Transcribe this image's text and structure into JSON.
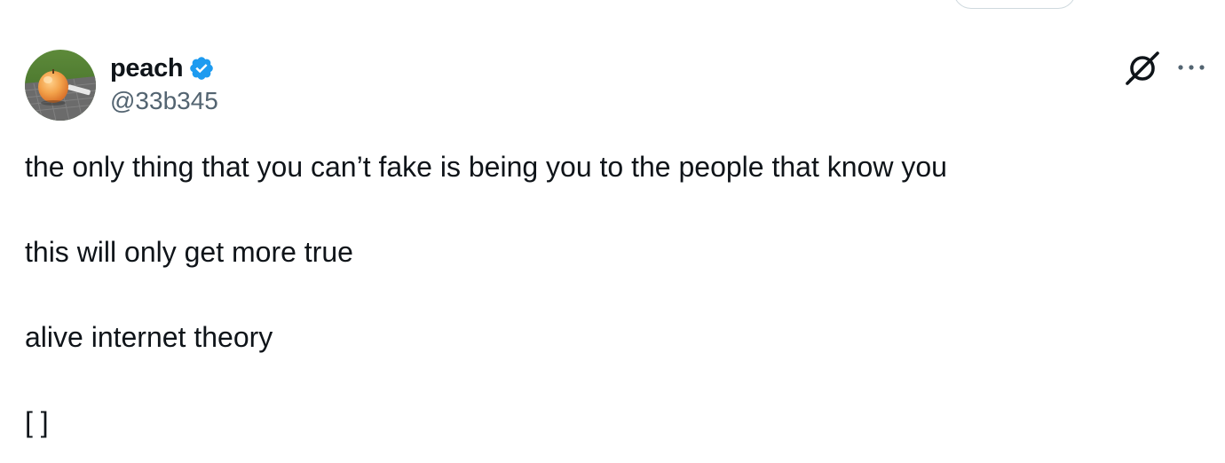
{
  "author": {
    "display_name": "peach",
    "handle": "@33b345",
    "verified": true,
    "verified_color": "#1d9bf0",
    "avatar_icon": "peach-photo-avatar"
  },
  "actions": {
    "grok_icon": "grok-icon",
    "more_icon": "more-options-icon"
  },
  "tweet": {
    "lines": [
      "the only thing that you can’t fake is being you to the people that know you",
      "this will only get more true",
      "alive internet theory",
      "[ ]"
    ]
  },
  "colors": {
    "text": "#0f1419",
    "secondary_text": "#536471",
    "border": "#cfd9de"
  }
}
